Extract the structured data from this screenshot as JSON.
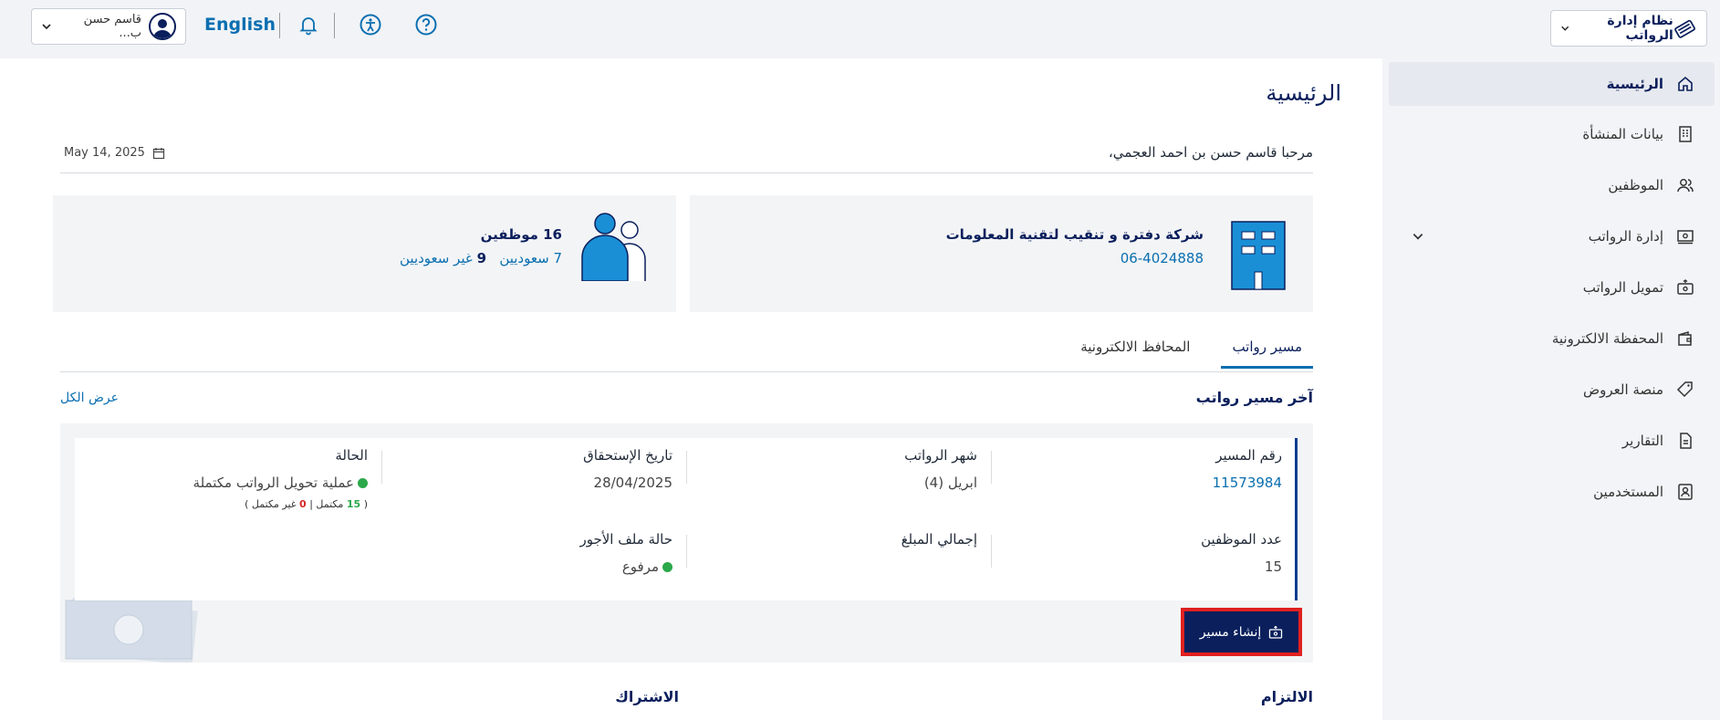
{
  "topbar": {
    "system_label": "نظام إدارة الرواتب",
    "user_name": "قاسم حسن ب...",
    "language_label": "English",
    "icons": [
      "help-icon",
      "accessibility-icon",
      "bell-icon"
    ]
  },
  "sidebar": {
    "items": [
      {
        "label": "الرئيسية",
        "icon": "home-icon"
      },
      {
        "label": "بيانات المنشأة",
        "icon": "building-icon"
      },
      {
        "label": "الموظفين",
        "icon": "users-icon"
      },
      {
        "label": "إدارة الرواتب",
        "icon": "payroll-icon"
      },
      {
        "label": "تمويل الرواتب",
        "icon": "wallet-cash-icon"
      },
      {
        "label": "المحفظة الالكترونية",
        "icon": "wallet-icon"
      },
      {
        "label": "منصة العروض",
        "icon": "tag-icon"
      },
      {
        "label": "التقارير",
        "icon": "report-icon"
      },
      {
        "label": "المستخدمين",
        "icon": "user-card-icon"
      }
    ]
  },
  "main": {
    "page_title": "الرئيسية",
    "welcome": "مرحبا قاسم حسن بن احمد العجمي،",
    "date": "May 14, 2025",
    "company": {
      "name": "شركة دفترة و تنقيب لتقنية المعلومات",
      "phone": "06-4024888"
    },
    "employees": {
      "total": "16 موظفين",
      "saudi_count": "7",
      "saudi_label": "سعوديين",
      "non_saudi_count": "9",
      "non_saudi_label": "غير سعوديين"
    },
    "tabs": [
      "مسير رواتب",
      "المحافظ الالكترونية"
    ],
    "section_title": "آخر مسير رواتب",
    "view_all": "عرض الكل",
    "run": {
      "run_no_label": "رقم المسير",
      "run_no": "11573984",
      "month_label": "شهر الرواتب",
      "month": "ابريل (4)",
      "due_label": "تاريخ الإستحقاق",
      "due": "28/04/2025",
      "status_label": "الحالة",
      "status": "عملية تحويل الرواتب مكتملة",
      "complete_count": "15",
      "complete_label": "مكتمل",
      "incomplete_count": "0",
      "incomplete_label": "غير مكتمل",
      "emp_count_label": "عدد الموظفين",
      "emp_count": "15",
      "total_label": "إجمالي المبلغ",
      "wps_label": "حالة ملف الأجور",
      "wps_status": "مرفوع"
    },
    "create_button": "إنشاء مسير",
    "bottom": {
      "commitment": "الالتزام",
      "subscription": "الاشتراك"
    }
  }
}
